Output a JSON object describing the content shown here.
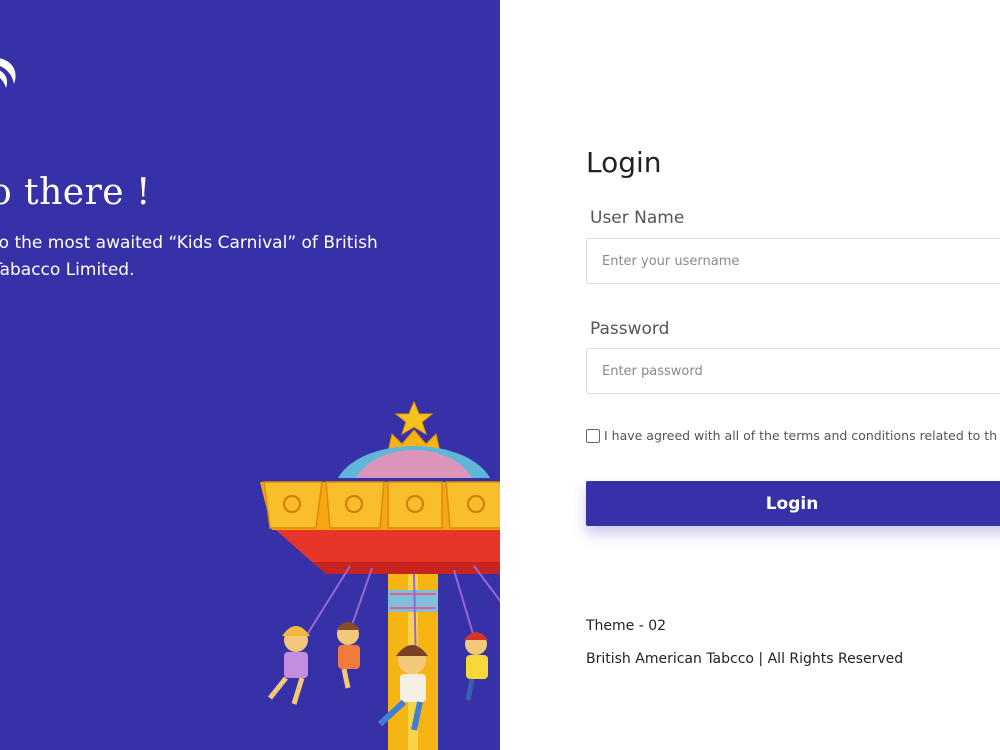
{
  "brand": {
    "panel_color": "#3731a8",
    "logo_icon": "brand-swirl-icon"
  },
  "hero": {
    "greeting": "o there !",
    "welcome_line1": "to the most awaited “Kids Carnival” of British",
    "welcome_line2": "Tabacco Limited."
  },
  "login": {
    "title": "Login",
    "username_label": "User Name",
    "username_placeholder": "Enter your username",
    "username_value": "",
    "password_label": "Password",
    "password_placeholder": "Enter password",
    "password_value": "",
    "terms_text": "I have agreed with all of the terms and conditions related to th",
    "terms_checked": false,
    "button_label": "Login",
    "button_color": "#3731a8"
  },
  "footer": {
    "theme": "Theme - 02",
    "rights": "British American Tabcco | All Rights Reserved"
  }
}
